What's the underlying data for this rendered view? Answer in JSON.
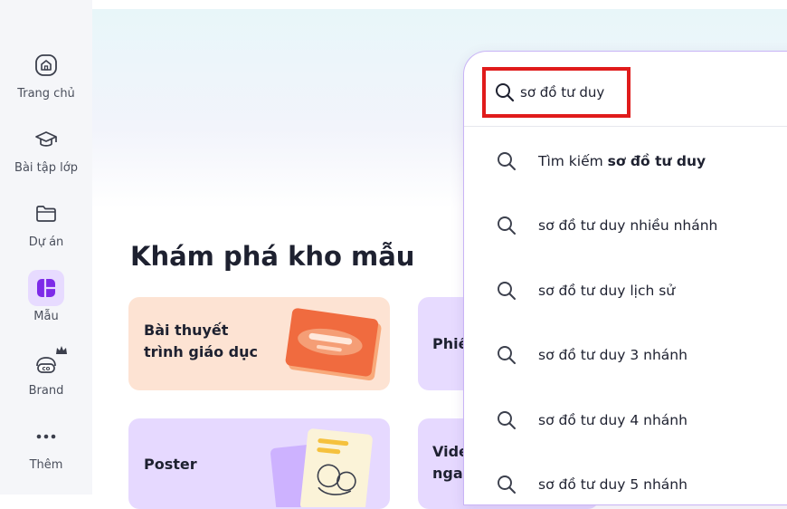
{
  "sidebar": {
    "items": [
      {
        "label": "Trang chủ",
        "icon": "home-icon"
      },
      {
        "label": "Bài tập lớp",
        "icon": "graduation-cap-icon"
      },
      {
        "label": "Dự án",
        "icon": "folder-icon"
      },
      {
        "label": "Mẫu",
        "icon": "templates-icon",
        "active": true
      },
      {
        "label": "Brand",
        "icon": "brand-icon",
        "badge": "crown-icon"
      },
      {
        "label": "Thêm",
        "icon": "more-icon"
      }
    ]
  },
  "main": {
    "title": "Khám phá kho mẫu",
    "cards": [
      {
        "label_line1": "Bài thuyết",
        "label_line2": "trình giáo dục"
      },
      {
        "label": "Phiế"
      },
      {
        "label": "Poster"
      },
      {
        "label_line1": "Vide",
        "label_line2": "nga"
      }
    ]
  },
  "search": {
    "value": "sơ đồ tư duy",
    "suggestions": [
      {
        "prefix": "Tìm kiếm ",
        "bold": "sơ đồ tư duy"
      },
      {
        "text": "sơ đồ tư duy nhiều nhánh"
      },
      {
        "text": "sơ đồ tư duy lịch sử"
      },
      {
        "text": "sơ đồ tư duy 3 nhánh"
      },
      {
        "text": "sơ đồ tư duy 4 nhánh"
      },
      {
        "text": "sơ đồ tư duy 5 nhánh"
      }
    ]
  },
  "colors": {
    "accent": "#7d2ae8",
    "highlight_box": "#e01b1b",
    "card_orange": "#fde3d3",
    "card_purple": "#e7dbff"
  }
}
